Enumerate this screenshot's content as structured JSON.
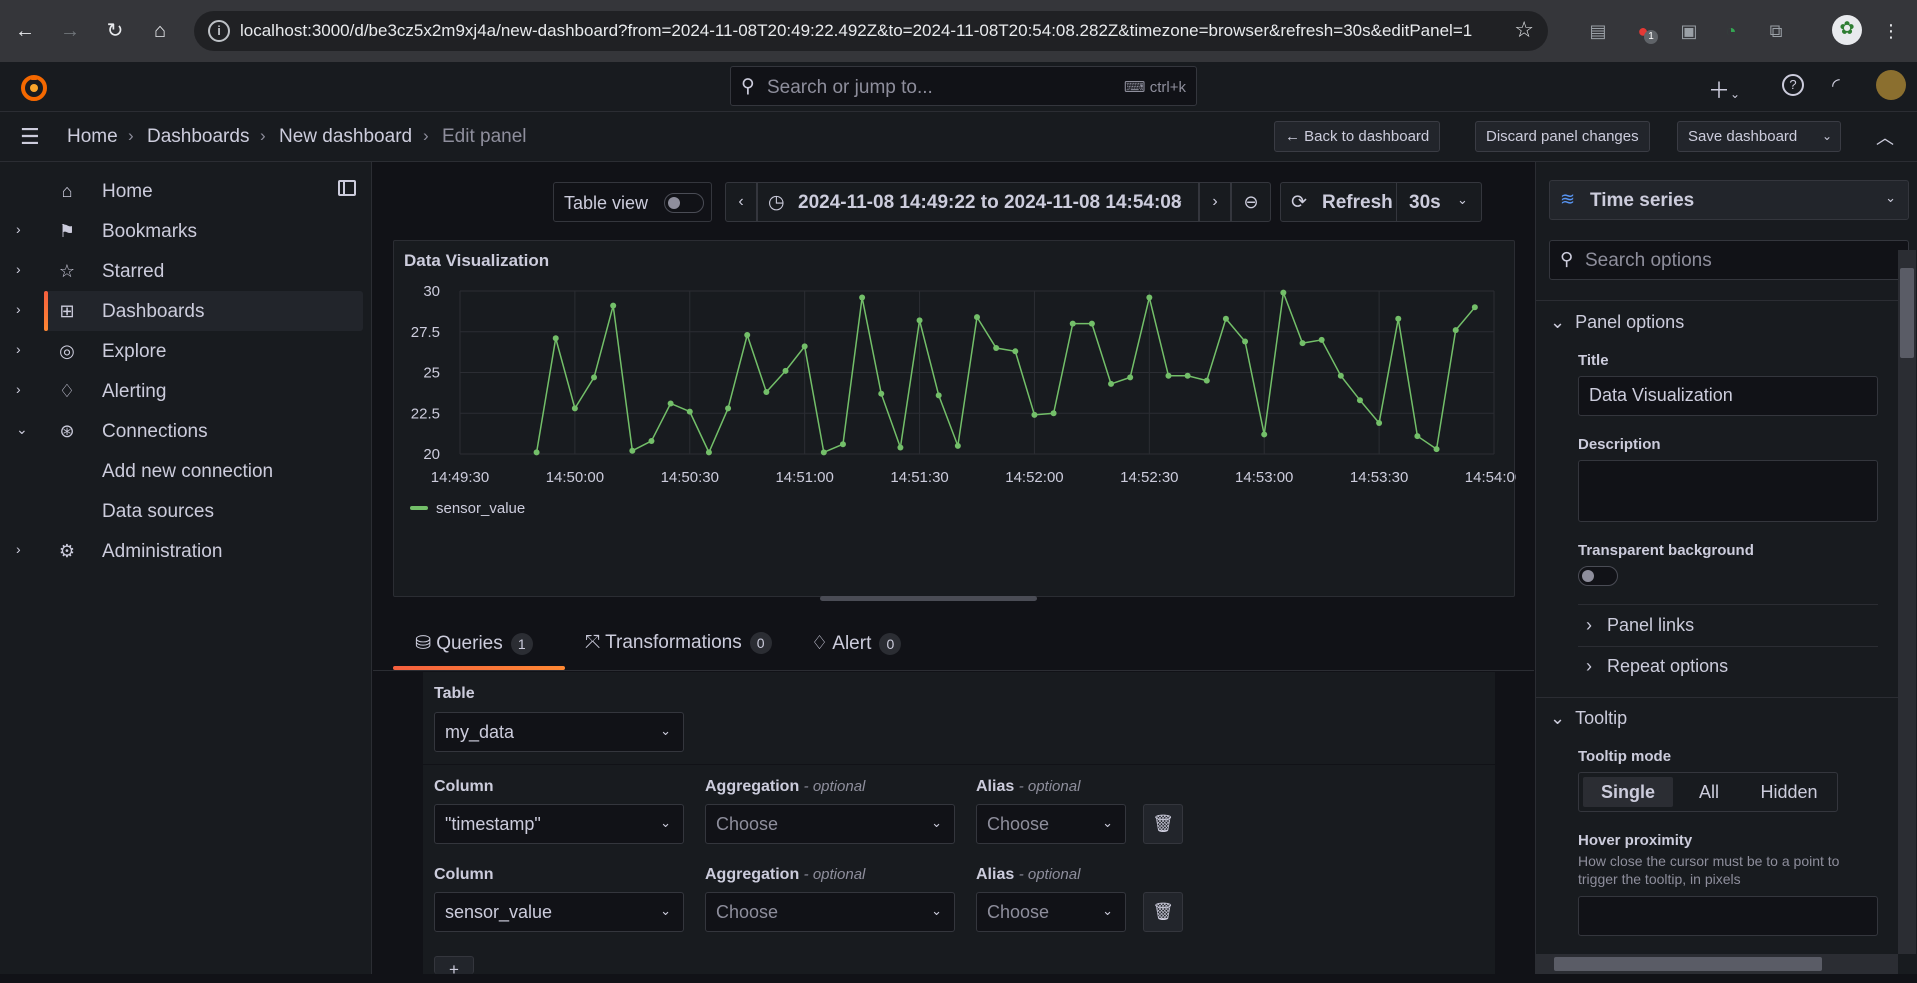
{
  "browser": {
    "url": "localhost:3000/d/be3cz5x2m9xj4a/new-dashboard?from=2024-11-08T20:49:22.492Z&to=2024-11-08T20:54:08.282Z&timezone=browser&refresh=30s&editPanel=1",
    "ext_badge": "1"
  },
  "topbar": {
    "search_placeholder": "Search or jump to...",
    "search_shortcut": "ctrl+k"
  },
  "breadcrumb": {
    "items": [
      "Home",
      "Dashboards",
      "New dashboard",
      "Edit panel"
    ]
  },
  "actions": {
    "back": "Back to dashboard",
    "discard": "Discard panel changes",
    "save": "Save dashboard"
  },
  "sidebar": {
    "items": [
      {
        "label": "Home",
        "icon": "home-icon"
      },
      {
        "label": "Bookmarks",
        "icon": "bookmark-icon"
      },
      {
        "label": "Starred",
        "icon": "star-icon"
      },
      {
        "label": "Dashboards",
        "icon": "apps-icon"
      },
      {
        "label": "Explore",
        "icon": "compass-icon"
      },
      {
        "label": "Alerting",
        "icon": "bell-icon"
      },
      {
        "label": "Connections",
        "icon": "connections-icon"
      },
      {
        "label": "Add new connection"
      },
      {
        "label": "Data sources"
      },
      {
        "label": "Administration",
        "icon": "cog-icon"
      }
    ]
  },
  "toolbar": {
    "table_view": "Table view",
    "time_range": "2024-11-08 14:49:22 to 2024-11-08 14:54:08",
    "refresh": "Refresh",
    "refresh_interval": "30s"
  },
  "panel": {
    "title": "Data Visualization"
  },
  "chart_data": {
    "type": "line",
    "title": "Data Visualization",
    "x_ticks": [
      "14:49:30",
      "14:50:00",
      "14:50:30",
      "14:51:00",
      "14:51:30",
      "14:52:00",
      "14:52:30",
      "14:53:00",
      "14:53:30",
      "14:54:00"
    ],
    "y_ticks": [
      "20",
      "22.5",
      "25",
      "27.5",
      "30"
    ],
    "ylim": [
      20,
      30
    ],
    "grid": true,
    "legend_position": "bottom-left",
    "series": [
      {
        "name": "sensor_value",
        "color": "#73bf69",
        "x_seconds": [
          0,
          5,
          10,
          15,
          20,
          25,
          30,
          35,
          40,
          45,
          50,
          55,
          60,
          65,
          70,
          75,
          80,
          85,
          90,
          95,
          100,
          105,
          110,
          115,
          120,
          125,
          130,
          135,
          140,
          145,
          150,
          155,
          160,
          165,
          170,
          175,
          180,
          185,
          190,
          195,
          200,
          205,
          210,
          215,
          220,
          225,
          230,
          235,
          240,
          245,
          250,
          255,
          260,
          265,
          270
        ],
        "x_start_label": "14:49:50",
        "values": [
          20.1,
          27.1,
          22.8,
          24.7,
          29.1,
          20.2,
          20.8,
          23.1,
          22.6,
          20.1,
          22.8,
          27.3,
          23.8,
          25.1,
          26.6,
          20.1,
          20.6,
          29.6,
          23.7,
          20.4,
          28.2,
          23.6,
          20.5,
          28.4,
          26.5,
          26.3,
          22.4,
          22.5,
          28.0,
          28.0,
          24.3,
          24.7,
          29.6,
          24.8,
          24.8,
          24.5,
          28.3,
          26.9,
          21.2,
          29.9,
          26.8,
          27.0,
          24.8,
          23.3,
          21.9,
          28.3,
          21.1,
          20.3,
          27.6,
          29.0
        ]
      }
    ]
  },
  "query_tabs": [
    {
      "label": "Queries",
      "count": "1"
    },
    {
      "label": "Transformations",
      "count": "0"
    },
    {
      "label": "Alert",
      "count": "0"
    }
  ],
  "query": {
    "table_label": "Table",
    "table_value": "my_data",
    "column_label": "Column",
    "aggregation_label": "Aggregation",
    "alias_label": "Alias",
    "optional": "- optional",
    "rows": [
      {
        "column": "\"timestamp\"",
        "aggregation": "Choose",
        "alias": "Choose"
      },
      {
        "column": "sensor_value",
        "aggregation": "Choose",
        "alias": "Choose"
      }
    ]
  },
  "options": {
    "viz_type": "Time series",
    "search_placeholder": "Search options",
    "panel_options": "Panel options",
    "title_label": "Title",
    "title_value": "Data Visualization",
    "description_label": "Description",
    "transparent_label": "Transparent background",
    "panel_links": "Panel links",
    "repeat_options": "Repeat options",
    "tooltip": "Tooltip",
    "tooltip_mode_label": "Tooltip mode",
    "tooltip_modes": [
      "Single",
      "All",
      "Hidden"
    ],
    "hover_label": "Hover proximity",
    "hover_desc": "How close the cursor must be to a point to trigger the tooltip, in pixels"
  }
}
